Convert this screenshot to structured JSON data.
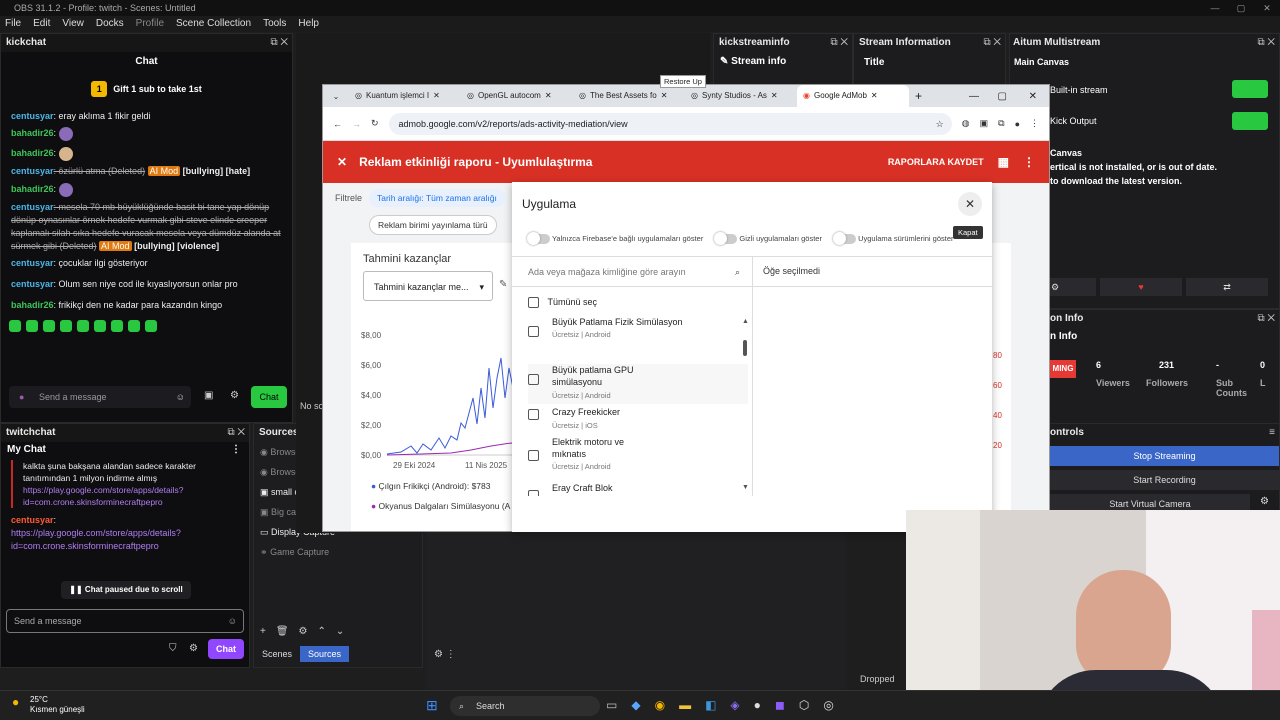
{
  "obs": {
    "title": "OBS 31.1.2 - Profile: twitch - Scenes: Untitled",
    "menu": [
      "File",
      "Edit",
      "View",
      "Docks",
      "Profile",
      "Scene Collection",
      "Tools",
      "Help"
    ]
  },
  "kick": {
    "header": "kickchat",
    "chat_title": "Chat",
    "gift": "Gift 1 sub to take 1st",
    "lines": [
      {
        "user": "centusyar",
        "text": ": eray aklıma 1 fikir geldi"
      },
      {
        "user": "bahadir26",
        "text": ":"
      },
      {
        "user": "bahadir26",
        "text": ":"
      },
      {
        "user": "centusyar",
        "text": ": özürlü atma (Deleted)",
        "tag": "AI Mod",
        "extra": "[bullying] [hate]"
      },
      {
        "user": "bahadir26",
        "text": ":"
      },
      {
        "user": "centusyar",
        "text": ": mesela 70 mb büyüklüğünde basit bi tane yap dönüp dönüp oynasınlar örnek hedefe vurmak gibi steve elinde creeper kaplamalı silah sıka hedefe vuracak mesela veya dümdüz alanda at sürmek gibi (Deleted)",
        "tag": "AI Mod",
        "extra": "[bullying] [violence]"
      },
      {
        "user": "centusyar",
        "text": ": çocuklar ilgi gösteriyor"
      },
      {
        "user": "centusyar",
        "text": ": Olum sen niye cod ile kıyaslıyorsun onlar pro"
      },
      {
        "user": "bahadir26",
        "text": ": frikikçi den ne kadar para kazandın kingo"
      }
    ],
    "input_placeholder": "Send a message",
    "chat_btn": "Chat"
  },
  "twitch": {
    "header": "twitchchat",
    "my_chat": "My Chat",
    "lines": [
      {
        "text": "kalkta şuna bakşana alandan sadece karakter tanıtımından 1 milyon indirme almış"
      },
      {
        "link": "https://play.google.com/store/apps/details?id=com.crone.skinsforminecraftpepro"
      },
      {
        "user": "centusyar",
        "text": ":"
      },
      {
        "link": "https://play.google.com/store/apps/details?id=com.crone.skinsforminecraftpepro"
      }
    ],
    "paused": "Chat paused due to scroll",
    "input_placeholder": "Send a message",
    "chat_btn": "Chat"
  },
  "sources": {
    "header": "Sources",
    "items": [
      "Browser 2",
      "Browser",
      "small cam",
      "Big cam",
      "Display Capture",
      "Game Capture"
    ],
    "tabs": [
      "Scenes",
      "Sources"
    ]
  },
  "browser": {
    "tabs": [
      "Kuantum işlemci I",
      "OpenGL autocom",
      "The Best Assets fo",
      "Synty Studios - As",
      "Google AdMob"
    ],
    "tooltip": "Restore Up",
    "url": "admob.google.com/v2/reports/ads-activity-mediation/view",
    "report_title": "Reklam etkinliği raporu - Uyumlulaştırma",
    "save_btn": "RAPORLARA KAYDET",
    "filter_label": "Filtrele",
    "chip1": "Tarih aralığı: Tüm zaman aralığı",
    "chip2": "Reklam birimi yayınlama türü",
    "earnings_title": "Tahmini kazançlar",
    "earnings_select": "Tahmini kazançlar me...",
    "y_ticks": [
      "$8,00",
      "$6,00",
      "$4,00",
      "$2,00",
      "$0,00"
    ],
    "x_ticks": [
      "29 Eki 2024",
      "11 Nis 2025"
    ],
    "legend": [
      {
        "name": "Çılgın Frikikçi (Android): $783",
        "color": "#3b5bdb"
      },
      {
        "name": "Okyanus Dalgaları Simülasyonu (A",
        "color": "#9c27b0"
      }
    ],
    "right_ticks": [
      "80",
      "60",
      "40",
      "20"
    ]
  },
  "modal": {
    "title": "Uygulama",
    "close_tooltip": "Kapat",
    "toggles": [
      "Yalnızca Firebase'e bağlı uygulamaları göster",
      "Gizli uygulamaları göster",
      "Uygulama sürümlerini göster"
    ],
    "search_placeholder": "Ada veya mağaza kimliğine göre arayın",
    "none_selected": "Öğe seçilmedi",
    "select_all": "Tümünü seç",
    "items": [
      {
        "name": "Büyük Patlama Fizik Simülasyon",
        "sub": "Ücretsiz | Android"
      },
      {
        "name": "Büyük patlama GPU simülasyonu",
        "sub": "Ücretsiz | Android"
      },
      {
        "name": "Crazy Freekicker",
        "sub": "Ücretsiz | iOS"
      },
      {
        "name": "Elektrik motoru ve mıknatıs",
        "sub": "Ücretsiz | Android"
      },
      {
        "name": "Eray Craft Blok",
        "sub": ""
      }
    ]
  },
  "kickinfo": {
    "header": "kickstreaminfo",
    "label": "Stream info"
  },
  "streaminfo": {
    "header": "Stream Information",
    "label": "Title"
  },
  "aitum": {
    "header": "Aitum Multistream",
    "main_canvas": "Main Canvas",
    "builtin": "Built-in stream",
    "kick_output": "Kick Output",
    "canvas": "Canvas",
    "warn1": "ertical is not installed, or is out of date.",
    "warn2": "to download the latest version."
  },
  "statinfo": {
    "header": "on Info",
    "sub": "n Info",
    "live": "MING",
    "stats": [
      {
        "value": "6",
        "label": "Viewers"
      },
      {
        "value": "231",
        "label": "Followers"
      },
      {
        "value": "-",
        "label": "Sub Counts"
      },
      {
        "value": "0",
        "label": "L"
      }
    ]
  },
  "controls": {
    "header": "ontrols",
    "stop": "Stop Streaming",
    "record": "Start Recording",
    "virtual": "Start Virtual Camera"
  },
  "status": {
    "dropped": "Dropped"
  },
  "taskbar": {
    "temp": "25°C",
    "weather": "Kısmen güneşli",
    "search": "Search"
  },
  "no_source": "No so"
}
